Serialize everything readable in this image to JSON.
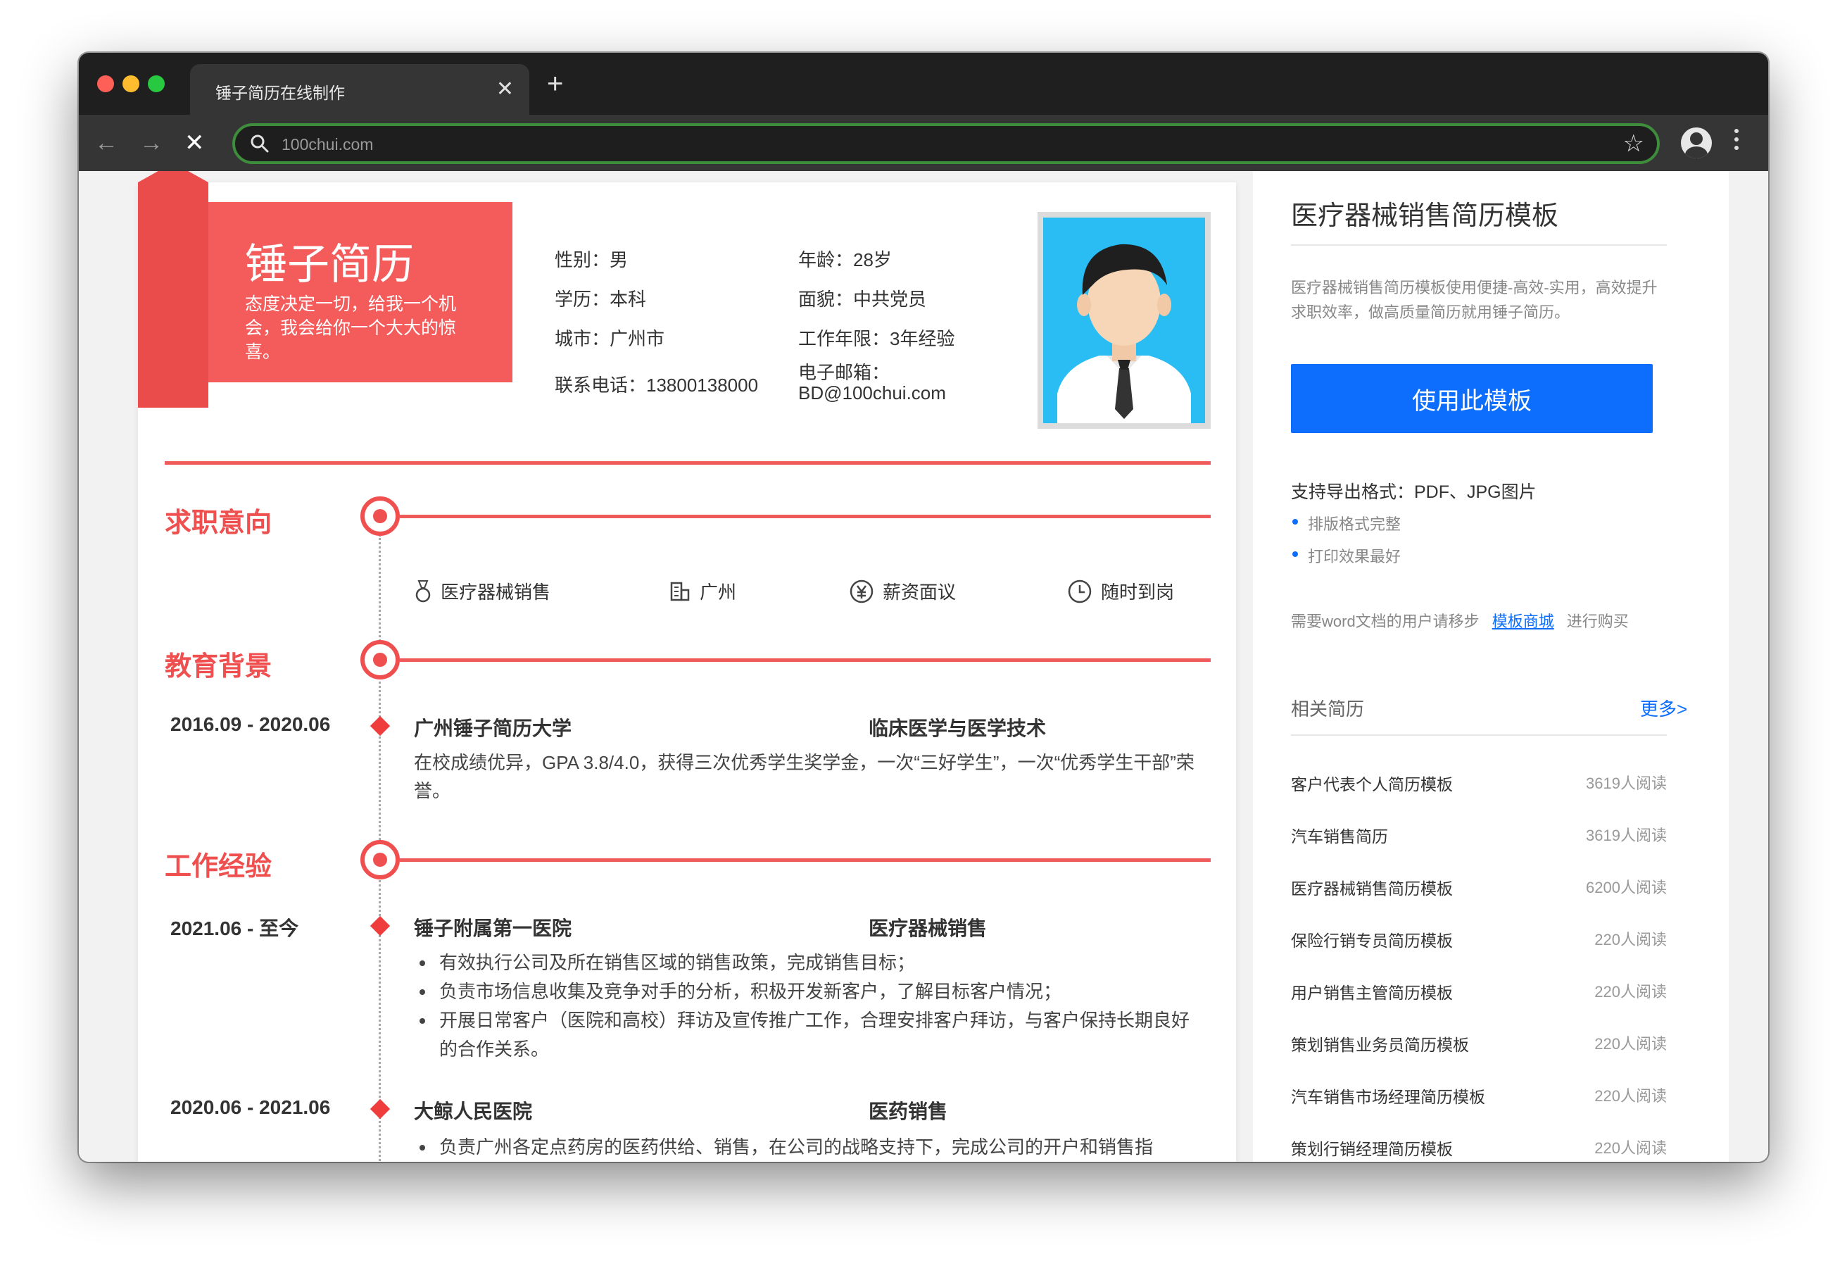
{
  "browser": {
    "tab_title": "锤子简历在线制作",
    "tab_close": "✕",
    "new_tab": "+",
    "url": "100chui.com",
    "back": "←",
    "forward": "→",
    "stop": "✕",
    "bookmark": "☆"
  },
  "resume": {
    "name": "锤子简历",
    "motto": "态度决定一切，给我一个机会，我会给你一个大大的惊喜。",
    "info": {
      "gender": "性别：男",
      "age": "年龄：28岁",
      "education": "学历：本科",
      "politics": "面貌：中共党员",
      "city": "城市：广州市",
      "experience": "工作年限：3年经验",
      "phone": "联系电话：13800138000",
      "email_label": "电子邮箱：",
      "email": "BD@100chui.com"
    },
    "sections": {
      "intent": "求职意向",
      "education": "教育背景",
      "work": "工作经验"
    },
    "intent_items": {
      "job": "医疗器械销售",
      "city": "广州",
      "salary": "薪资面议",
      "availability": "随时到岗"
    },
    "education": {
      "date": "2016.09 - 2020.06",
      "school": "广州锤子简历大学",
      "major": "临床医学与医学技术",
      "desc": "在校成绩优异，GPA 3.8/4.0，获得三次优秀学生奖学金，一次“三好学生”，一次“优秀学生干部”荣誉。"
    },
    "work": [
      {
        "date": "2021.06 - 至今",
        "org": "锤子附属第一医院",
        "role": "医疗器械销售",
        "bullets": [
          "有效执行公司及所在销售区域的销售政策，完成销售目标；",
          "负责市场信息收集及竞争对手的分析，积极开发新客户，了解目标客户情况；",
          "开展日常客户（医院和高校）拜访及宣传推广工作，合理安排客户拜访，与客户保持长期良好的合作关系。"
        ]
      },
      {
        "date": "2020.06 - 2021.06",
        "org": "大鲸人民医院",
        "role": "医药销售",
        "bullets": [
          "负责广州各定点药房的医药供给、销售，在公司的战略支持下，完成公司的开户和销售指"
        ]
      }
    ]
  },
  "sidebar": {
    "title": "医疗器械销售简历模板",
    "desc": "医疗器械销售简历模板使用便捷-高效-实用，高效提升求职效率，做高质量简历就用锤子简历。",
    "use_button": "使用此模板",
    "export": "支持导出格式：PDF、JPG图片",
    "features": [
      "排版格式完整",
      "打印效果最好"
    ],
    "word_note_prefix": "需要word文档的用户请移步",
    "word_note_link": "模板商城",
    "word_note_suffix": "进行购买",
    "related_title": "相关简历",
    "related_more": "更多>",
    "related": [
      {
        "name": "客户代表个人简历模板",
        "count": "3619人阅读"
      },
      {
        "name": "汽车销售简历",
        "count": "3619人阅读"
      },
      {
        "name": "医疗器械销售简历模板",
        "count": "6200人阅读"
      },
      {
        "name": "保险行销专员简历模板",
        "count": "220人阅读"
      },
      {
        "name": "用户销售主管简历模板",
        "count": "220人阅读"
      },
      {
        "name": "策划销售业务员简历模板",
        "count": "220人阅读"
      },
      {
        "name": "汽车销售市场经理简历模板",
        "count": "220人阅读"
      },
      {
        "name": "策划行销经理简历模板",
        "count": "220人阅读"
      }
    ]
  },
  "colors": {
    "accent_red": "#ef4f4f",
    "banner_red": "#f45c5c",
    "button_blue": "#0d6efd",
    "photo_bg": "#29bdf4"
  }
}
